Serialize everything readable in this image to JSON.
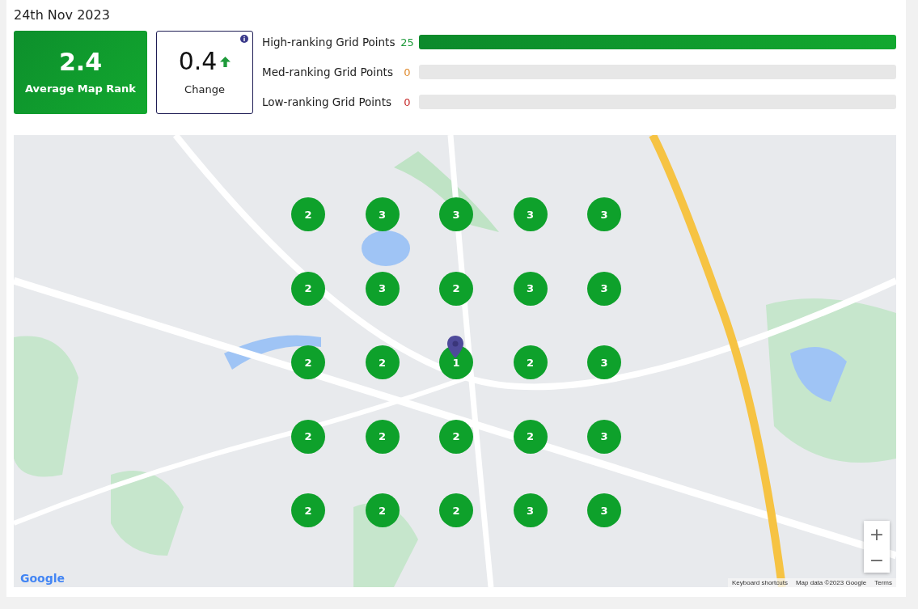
{
  "date": "24th Nov 2023",
  "average": {
    "value": "2.4",
    "label": "Average Map Rank"
  },
  "change": {
    "value": "0.4",
    "rising": true,
    "label": "Change"
  },
  "rankings": [
    {
      "label": "High-ranking Grid Points",
      "count": "25",
      "level": 1,
      "color": "#1e9a3a"
    },
    {
      "label": "Med-ranking Grid Points",
      "count": "0",
      "level": 0,
      "color": "#e08a2c"
    },
    {
      "label": "Low-ranking Grid Points",
      "count": "0",
      "level": 0,
      "color": "#c62828"
    }
  ],
  "map": {
    "kind": "picture",
    "grid": [
      [
        "2",
        "3",
        "3",
        "3",
        "3"
      ],
      [
        "2",
        "3",
        "2",
        "3",
        "3"
      ],
      [
        "2",
        "2",
        "1",
        "2",
        "3"
      ],
      [
        "2",
        "2",
        "2",
        "2",
        "3"
      ],
      [
        "2",
        "2",
        "2",
        "3",
        "3"
      ]
    ],
    "zoom_in": "+",
    "zoom_out": "−",
    "logo": "Google",
    "attribution": [
      "Keyboard shortcuts",
      "Map data ©2023 Google",
      "Terms"
    ]
  }
}
